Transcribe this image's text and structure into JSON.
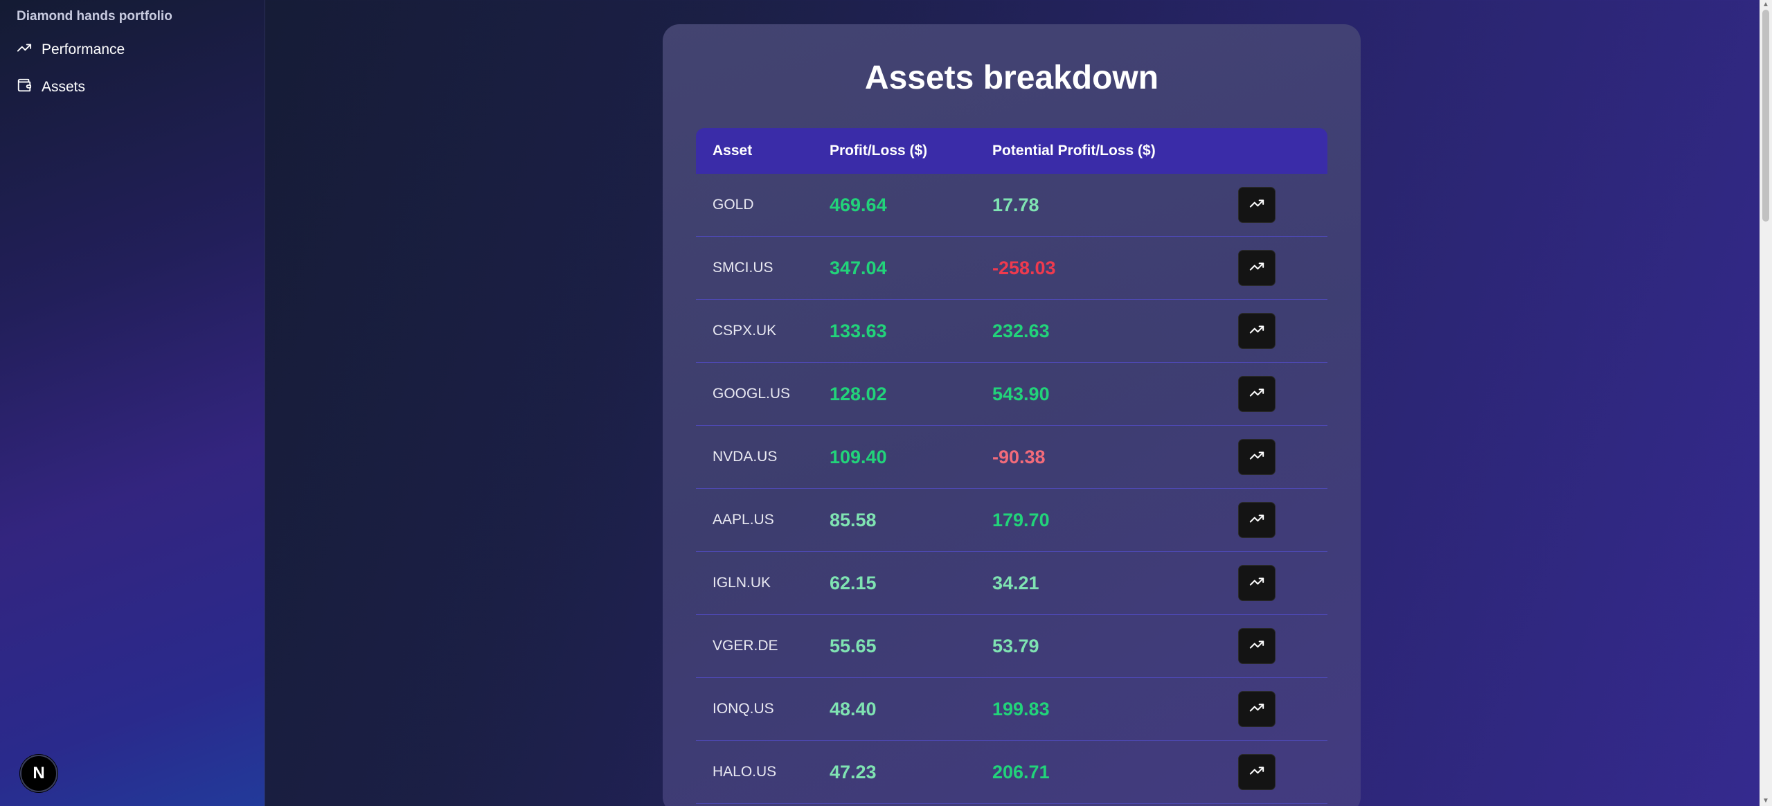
{
  "sidebar": {
    "brand": "Diamond hands portfolio",
    "items": [
      {
        "label": "Performance",
        "icon": "trending-up-icon"
      },
      {
        "label": "Assets",
        "icon": "wallet-icon"
      }
    ],
    "badge": "N"
  },
  "main": {
    "title": "Assets breakdown",
    "columns": [
      "Asset",
      "Profit/Loss ($)",
      "Potential Profit/Loss ($)"
    ],
    "rows": [
      {
        "asset": "GOLD",
        "pl": "469.64",
        "potential": "17.78"
      },
      {
        "asset": "SMCI.US",
        "pl": "347.04",
        "potential": "-258.03"
      },
      {
        "asset": "CSPX.UK",
        "pl": "133.63",
        "potential": "232.63"
      },
      {
        "asset": "GOOGL.US",
        "pl": "128.02",
        "potential": "543.90"
      },
      {
        "asset": "NVDA.US",
        "pl": "109.40",
        "potential": "-90.38"
      },
      {
        "asset": "AAPL.US",
        "pl": "85.58",
        "potential": "179.70"
      },
      {
        "asset": "IGLN.UK",
        "pl": "62.15",
        "potential": "34.21"
      },
      {
        "asset": "VGER.DE",
        "pl": "55.65",
        "potential": "53.79"
      },
      {
        "asset": "IONQ.US",
        "pl": "48.40",
        "potential": "199.83"
      },
      {
        "asset": "HALO.US",
        "pl": "47.23",
        "potential": "206.71"
      }
    ]
  },
  "colors": {
    "positive_strong": "#22d37a",
    "positive_soft": "#7fe3b2",
    "negative_strong": "#ef3a4e",
    "negative_soft": "#f26b7a",
    "header_bg": "#3a2ca8"
  }
}
